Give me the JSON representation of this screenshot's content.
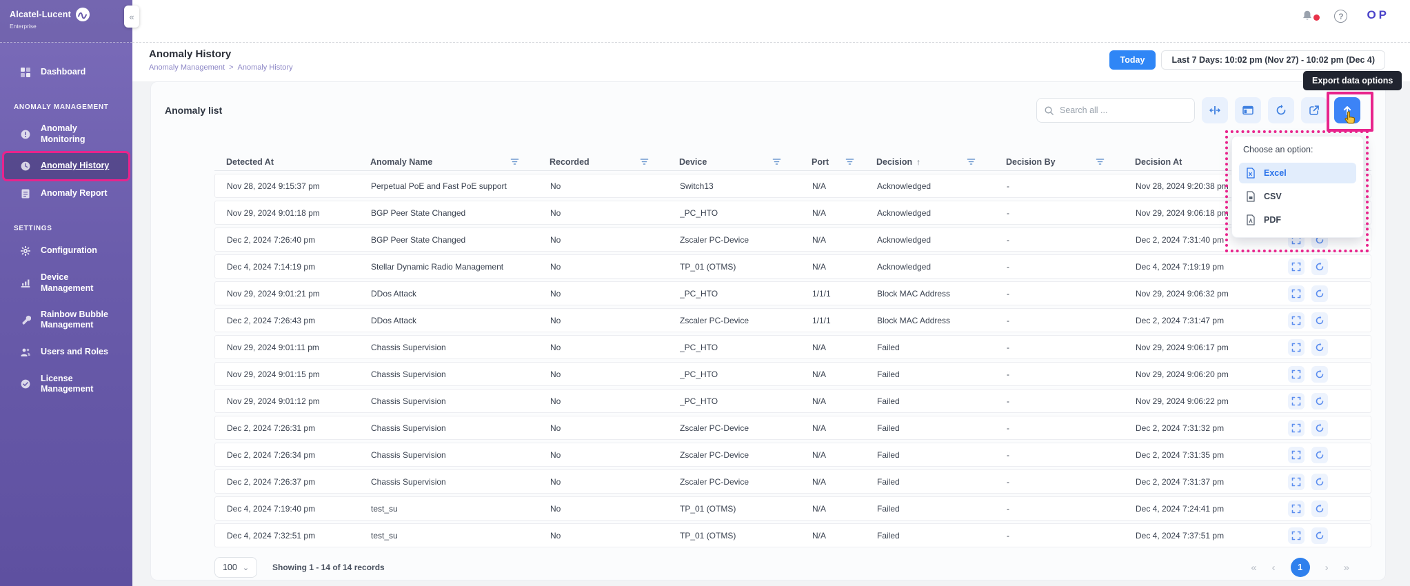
{
  "brand": {
    "name": "Alcatel-Lucent",
    "sub": "Enterprise"
  },
  "topbar": {
    "user_initials": "OP"
  },
  "sidebar": {
    "groups": [
      {
        "label": "",
        "items": [
          {
            "label": "Dashboard"
          }
        ]
      },
      {
        "label": "ANOMALY MANAGEMENT",
        "items": [
          {
            "label": "Anomaly Monitoring"
          },
          {
            "label": "Anomaly History",
            "active": true
          },
          {
            "label": "Anomaly Report"
          }
        ]
      },
      {
        "label": "SETTINGS",
        "items": [
          {
            "label": "Configuration"
          },
          {
            "label": "Device Management"
          },
          {
            "label": "Rainbow Bubble Management"
          },
          {
            "label": "Users and Roles"
          },
          {
            "label": "License Management"
          }
        ]
      }
    ]
  },
  "header": {
    "title": "Anomaly History",
    "breadcrumb": {
      "parent": "Anomaly Management",
      "separator": ">",
      "current": "Anomaly History"
    },
    "today_label": "Today",
    "date_range": "Last 7 Days: 10:02 pm (Nov 27) - 10:02 pm (Dec 4)"
  },
  "tooltip": {
    "text": "Export data options"
  },
  "panel": {
    "title": "Anomaly list",
    "search_placeholder": "Search all ..."
  },
  "dropdown": {
    "title": "Choose an option:",
    "options": [
      {
        "label": "Excel"
      },
      {
        "label": "CSV"
      },
      {
        "label": "PDF"
      }
    ]
  },
  "table": {
    "columns": [
      {
        "label": "Detected At"
      },
      {
        "label": "Anomaly Name",
        "filter": true
      },
      {
        "label": "Recorded",
        "filter": true
      },
      {
        "label": "Device",
        "filter": true
      },
      {
        "label": "Port",
        "filter": true
      },
      {
        "label": "Decision",
        "filter": true,
        "sorted": "asc"
      },
      {
        "label": "Decision By",
        "filter": true
      },
      {
        "label": "Decision At"
      }
    ],
    "rows": [
      {
        "detected": "Nov 28, 2024 9:15:37 pm",
        "name": "Perpetual PoE and Fast PoE support",
        "recorded": "No",
        "device": "Switch13",
        "port": "N/A",
        "decision": "Acknowledged",
        "by": "-",
        "at": "Nov 28, 2024 9:20:38 pm"
      },
      {
        "detected": "Nov 29, 2024 9:01:18 pm",
        "name": "BGP Peer State Changed",
        "recorded": "No",
        "device": "_PC_HTO",
        "port": "N/A",
        "decision": "Acknowledged",
        "by": "-",
        "at": "Nov 29, 2024 9:06:18 pm"
      },
      {
        "detected": "Dec 2, 2024 7:26:40 pm",
        "name": "BGP Peer State Changed",
        "recorded": "No",
        "device": "Zscaler PC-Device",
        "port": "N/A",
        "decision": "Acknowledged",
        "by": "-",
        "at": "Dec 2, 2024 7:31:40 pm"
      },
      {
        "detected": "Dec 4, 2024 7:14:19 pm",
        "name": "Stellar Dynamic Radio Management",
        "recorded": "No",
        "device": "TP_01 (OTMS)",
        "port": "N/A",
        "decision": "Acknowledged",
        "by": "-",
        "at": "Dec 4, 2024 7:19:19 pm"
      },
      {
        "detected": "Nov 29, 2024 9:01:21 pm",
        "name": "DDos Attack",
        "recorded": "No",
        "device": "_PC_HTO",
        "port": "1/1/1",
        "decision": "Block MAC Address",
        "by": "-",
        "at": "Nov 29, 2024 9:06:32 pm"
      },
      {
        "detected": "Dec 2, 2024 7:26:43 pm",
        "name": "DDos Attack",
        "recorded": "No",
        "device": "Zscaler PC-Device",
        "port": "1/1/1",
        "decision": "Block MAC Address",
        "by": "-",
        "at": "Dec 2, 2024 7:31:47 pm"
      },
      {
        "detected": "Nov 29, 2024 9:01:11 pm",
        "name": "Chassis Supervision",
        "recorded": "No",
        "device": "_PC_HTO",
        "port": "N/A",
        "decision": "Failed",
        "by": "-",
        "at": "Nov 29, 2024 9:06:17 pm"
      },
      {
        "detected": "Nov 29, 2024 9:01:15 pm",
        "name": "Chassis Supervision",
        "recorded": "No",
        "device": "_PC_HTO",
        "port": "N/A",
        "decision": "Failed",
        "by": "-",
        "at": "Nov 29, 2024 9:06:20 pm"
      },
      {
        "detected": "Nov 29, 2024 9:01:12 pm",
        "name": "Chassis Supervision",
        "recorded": "No",
        "device": "_PC_HTO",
        "port": "N/A",
        "decision": "Failed",
        "by": "-",
        "at": "Nov 29, 2024 9:06:22 pm"
      },
      {
        "detected": "Dec 2, 2024 7:26:31 pm",
        "name": "Chassis Supervision",
        "recorded": "No",
        "device": "Zscaler PC-Device",
        "port": "N/A",
        "decision": "Failed",
        "by": "-",
        "at": "Dec 2, 2024 7:31:32 pm"
      },
      {
        "detected": "Dec 2, 2024 7:26:34 pm",
        "name": "Chassis Supervision",
        "recorded": "No",
        "device": "Zscaler PC-Device",
        "port": "N/A",
        "decision": "Failed",
        "by": "-",
        "at": "Dec 2, 2024 7:31:35 pm"
      },
      {
        "detected": "Dec 2, 2024 7:26:37 pm",
        "name": "Chassis Supervision",
        "recorded": "No",
        "device": "Zscaler PC-Device",
        "port": "N/A",
        "decision": "Failed",
        "by": "-",
        "at": "Dec 2, 2024 7:31:37 pm"
      },
      {
        "detected": "Dec 4, 2024 7:19:40 pm",
        "name": "test_su",
        "recorded": "No",
        "device": "TP_01 (OTMS)",
        "port": "N/A",
        "decision": "Failed",
        "by": "-",
        "at": "Dec 4, 2024 7:24:41 pm"
      },
      {
        "detected": "Dec 4, 2024 7:32:51 pm",
        "name": "test_su",
        "recorded": "No",
        "device": "TP_01 (OTMS)",
        "port": "N/A",
        "decision": "Failed",
        "by": "-",
        "at": "Dec 4, 2024 7:37:51 pm"
      }
    ]
  },
  "footer": {
    "page_size": "100",
    "showing": "Showing 1 - 14 of 14 records",
    "current_page": "1"
  },
  "icons": {
    "collapse": "«",
    "sort_asc": "↑",
    "help_glyph": "?",
    "select_chevron": "⌄",
    "pag_first": "«",
    "pag_prev": "‹",
    "pag_next": "›",
    "pag_last": "»"
  },
  "colors": {
    "accent_blue": "#2f86f6",
    "annotation_pink": "#e8248c",
    "sidebar_purple": "#6a5cab",
    "tooltip_bg": "#20242f",
    "notification_red": "#e8334a"
  }
}
